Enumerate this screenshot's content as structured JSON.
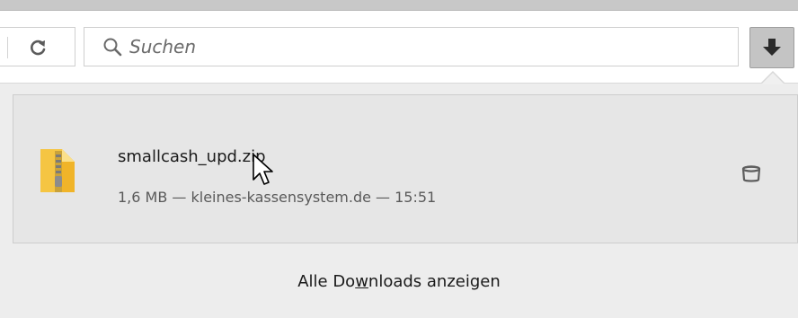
{
  "toolbar": {
    "reload_icon": "reload-icon",
    "search": {
      "placeholder": "Suchen",
      "icon": "search-icon"
    },
    "download_button_icon": "download-arrow-icon"
  },
  "downloads_panel": {
    "items": [
      {
        "file_name": "smallcash_upd.zip",
        "meta": "1,6 MB — kleines-kassensystem.de — 15:51",
        "file_icon": "zip-file-icon",
        "action_icon": "open-folder-icon"
      }
    ],
    "show_all_prefix": "Alle Do",
    "show_all_accesskey": "w",
    "show_all_suffix": "nloads anzeigen",
    "show_all_label": "Alle Downloads anzeigen"
  },
  "colors": {
    "panel_bg": "#ededed",
    "item_bg": "#e6e6e6",
    "download_button_bg": "#c4c4c4",
    "zip_yellow": "#f5c542"
  }
}
